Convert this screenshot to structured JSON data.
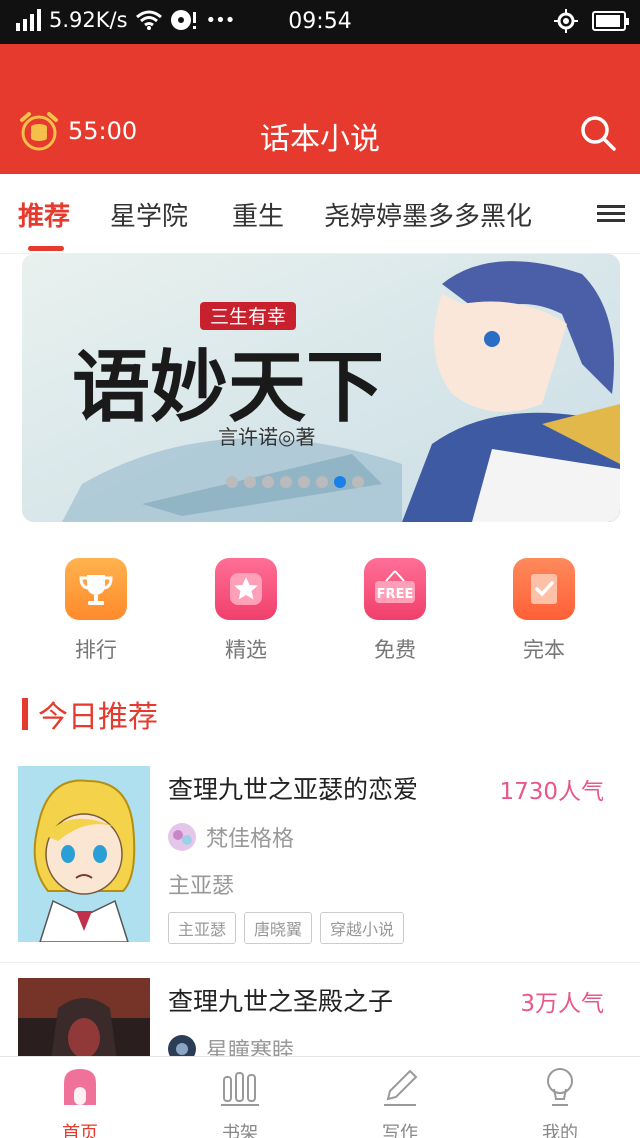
{
  "status_bar": {
    "net_speed": "5.92K/s",
    "time": "09:54",
    "dots": "•••"
  },
  "header": {
    "timer": "55:00",
    "title": "话本小说"
  },
  "tabs": [
    {
      "label": "推荐",
      "active": true
    },
    {
      "label": "星学院"
    },
    {
      "label": "重生"
    },
    {
      "label": "尧婷婷墨多多黑化"
    },
    {
      "label": "E"
    }
  ],
  "banner": {
    "subtitle": "三生有幸",
    "title": "语妙天下",
    "author": "言许诺◎著",
    "dots_total": 8,
    "dots_active": 7
  },
  "quick_entries": [
    {
      "label": "排行",
      "icon": "trophy-icon",
      "color": "#ff9a3c"
    },
    {
      "label": "精选",
      "icon": "star-icon",
      "color": "#f5507a"
    },
    {
      "label": "免费",
      "icon": "free-icon",
      "badge": "FREE",
      "color": "#f5507a"
    },
    {
      "label": "完本",
      "icon": "check-book-icon",
      "color": "#ff7043"
    }
  ],
  "section": {
    "title": "今日推荐"
  },
  "books": [
    {
      "title": "查理九世之亚瑟的恋爱",
      "popularity": "1730人气",
      "author": "梵佳格格",
      "desc": "主亚瑟",
      "tags": [
        "主亚瑟",
        "唐晓翼",
        "穿越小说"
      ]
    },
    {
      "title": "查理九世之圣殿之子",
      "popularity": "3万人气",
      "author": "星瞳寒睦"
    }
  ],
  "bottom_nav": [
    {
      "label": "首页",
      "icon": "home-icon",
      "active": true
    },
    {
      "label": "书架",
      "icon": "bookshelf-icon"
    },
    {
      "label": "写作",
      "icon": "pen-icon"
    },
    {
      "label": "我的",
      "icon": "profile-icon"
    }
  ],
  "colors": {
    "brand": "#e53a2d",
    "pink": "#e8568a"
  }
}
